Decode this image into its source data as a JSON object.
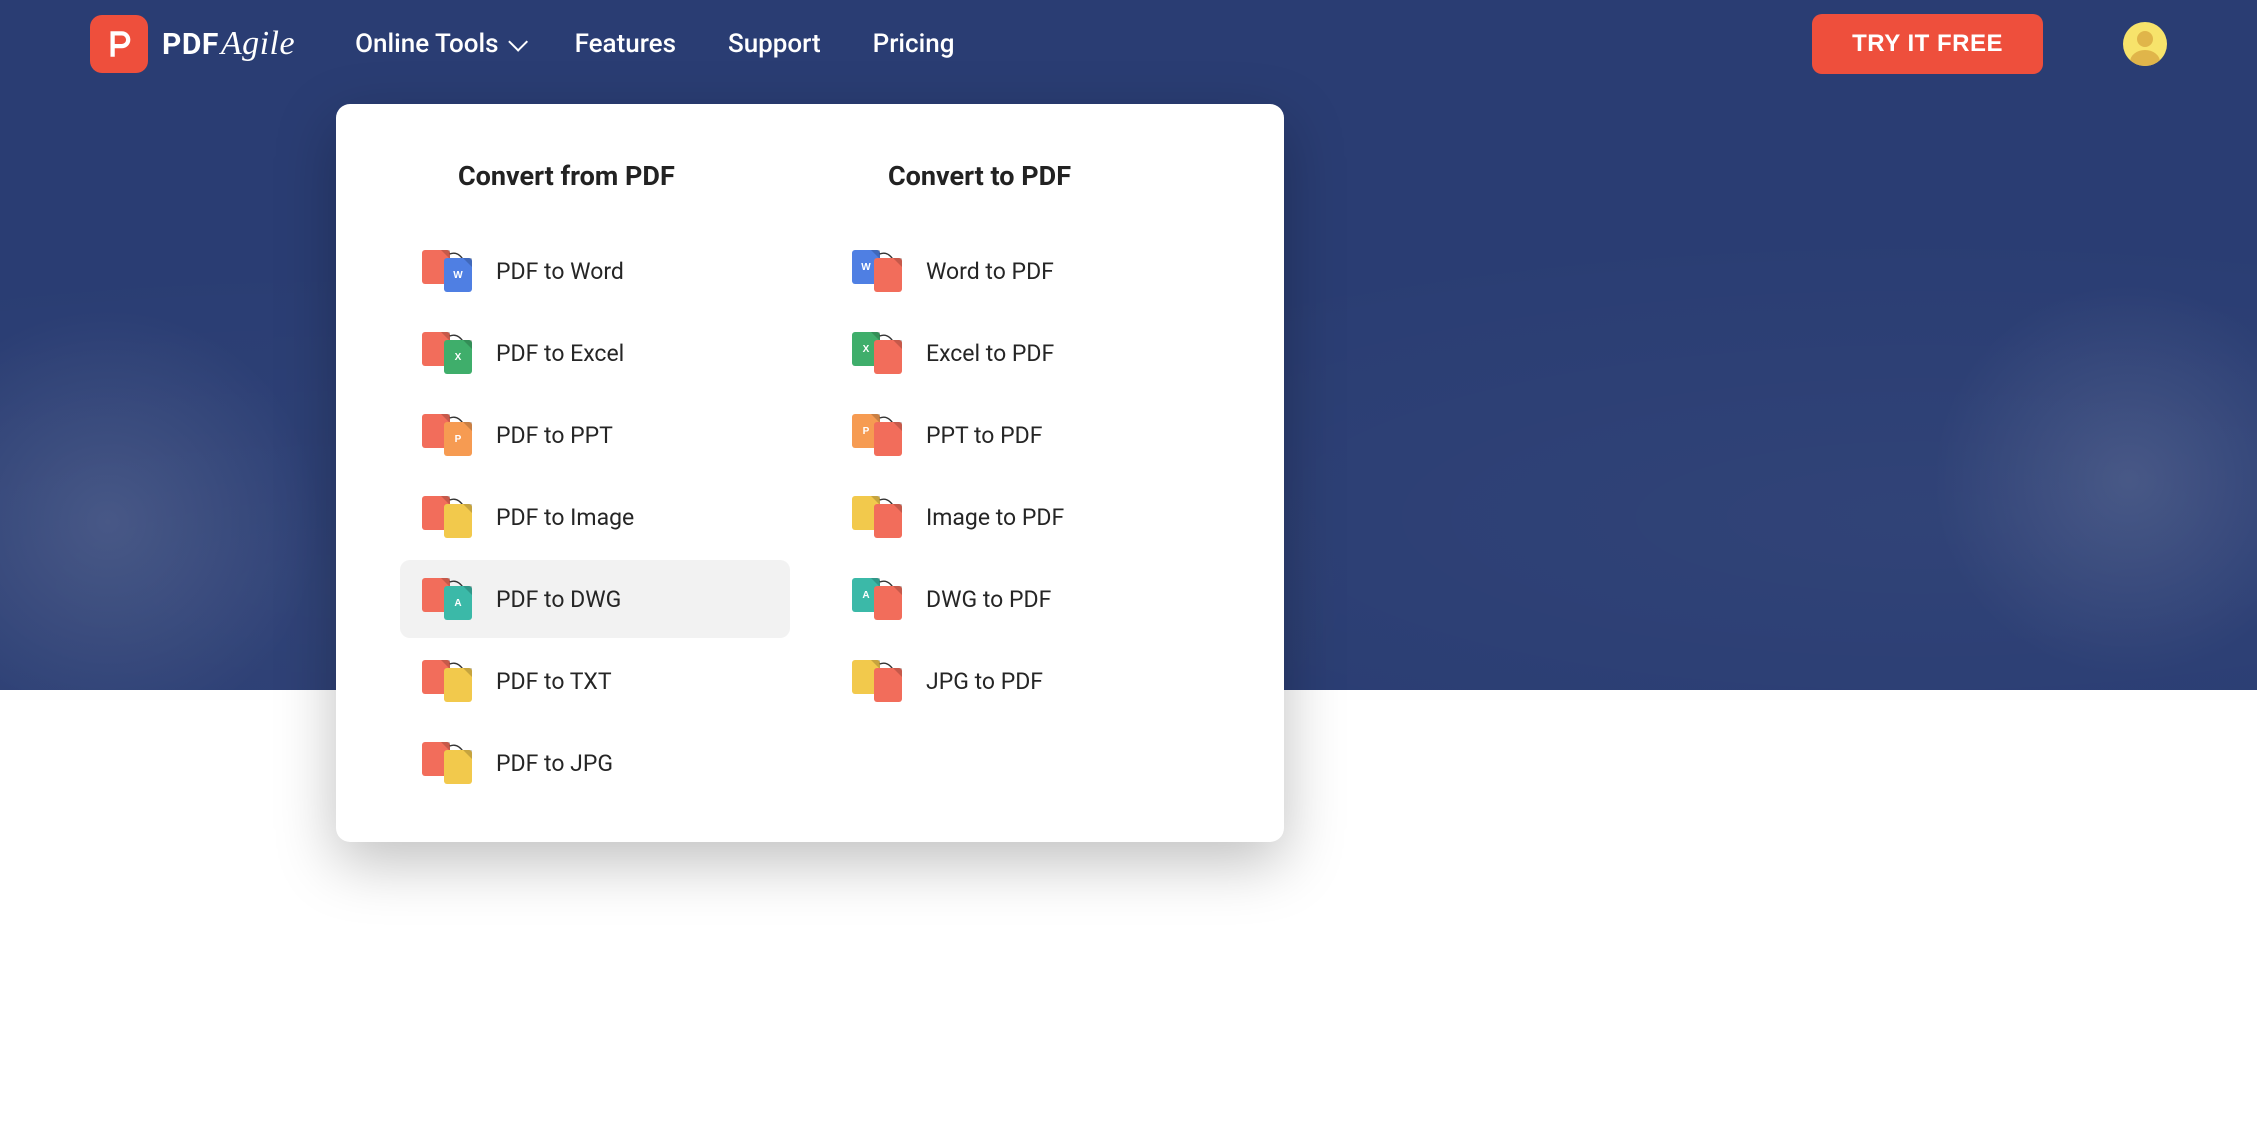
{
  "brand": {
    "name": "PDF",
    "sub": "Agile"
  },
  "nav": {
    "online_tools": "Online Tools",
    "features": "Features",
    "support": "Support",
    "pricing": "Pricing",
    "cta": "TRY IT FREE"
  },
  "dropdown": {
    "col_from_title": "Convert from PDF",
    "col_to_title": "Convert to PDF",
    "from": [
      {
        "label": "PDF to Word",
        "back": "pdf",
        "front": "word",
        "glyph_b": "",
        "glyph_f": "W"
      },
      {
        "label": "PDF to Excel",
        "back": "pdf",
        "front": "excel",
        "glyph_b": "",
        "glyph_f": "X"
      },
      {
        "label": "PDF to PPT",
        "back": "pdf",
        "front": "ppt",
        "glyph_b": "",
        "glyph_f": "P"
      },
      {
        "label": "PDF to Image",
        "back": "pdf",
        "front": "img",
        "glyph_b": "",
        "glyph_f": ""
      },
      {
        "label": "PDF to DWG",
        "back": "pdf",
        "front": "dwg",
        "glyph_b": "",
        "glyph_f": "A",
        "highlight": true
      },
      {
        "label": "PDF to TXT",
        "back": "pdf",
        "front": "txt",
        "glyph_b": "",
        "glyph_f": ""
      },
      {
        "label": "PDF to JPG",
        "back": "pdf",
        "front": "img",
        "glyph_b": "",
        "glyph_f": ""
      }
    ],
    "to": [
      {
        "label": "Word to PDF",
        "back": "word",
        "front": "pdf",
        "glyph_b": "W",
        "glyph_f": ""
      },
      {
        "label": "Excel to PDF",
        "back": "excel",
        "front": "pdf",
        "glyph_b": "X",
        "glyph_f": ""
      },
      {
        "label": "PPT to PDF",
        "back": "ppt",
        "front": "pdf",
        "glyph_b": "P",
        "glyph_f": ""
      },
      {
        "label": "Image to PDF",
        "back": "img",
        "front": "pdf",
        "glyph_b": "",
        "glyph_f": ""
      },
      {
        "label": "DWG to PDF",
        "back": "dwg",
        "front": "pdf",
        "glyph_b": "A",
        "glyph_f": ""
      },
      {
        "label": "JPG to PDF",
        "back": "img",
        "front": "pdf",
        "glyph_b": "",
        "glyph_f": ""
      }
    ]
  }
}
